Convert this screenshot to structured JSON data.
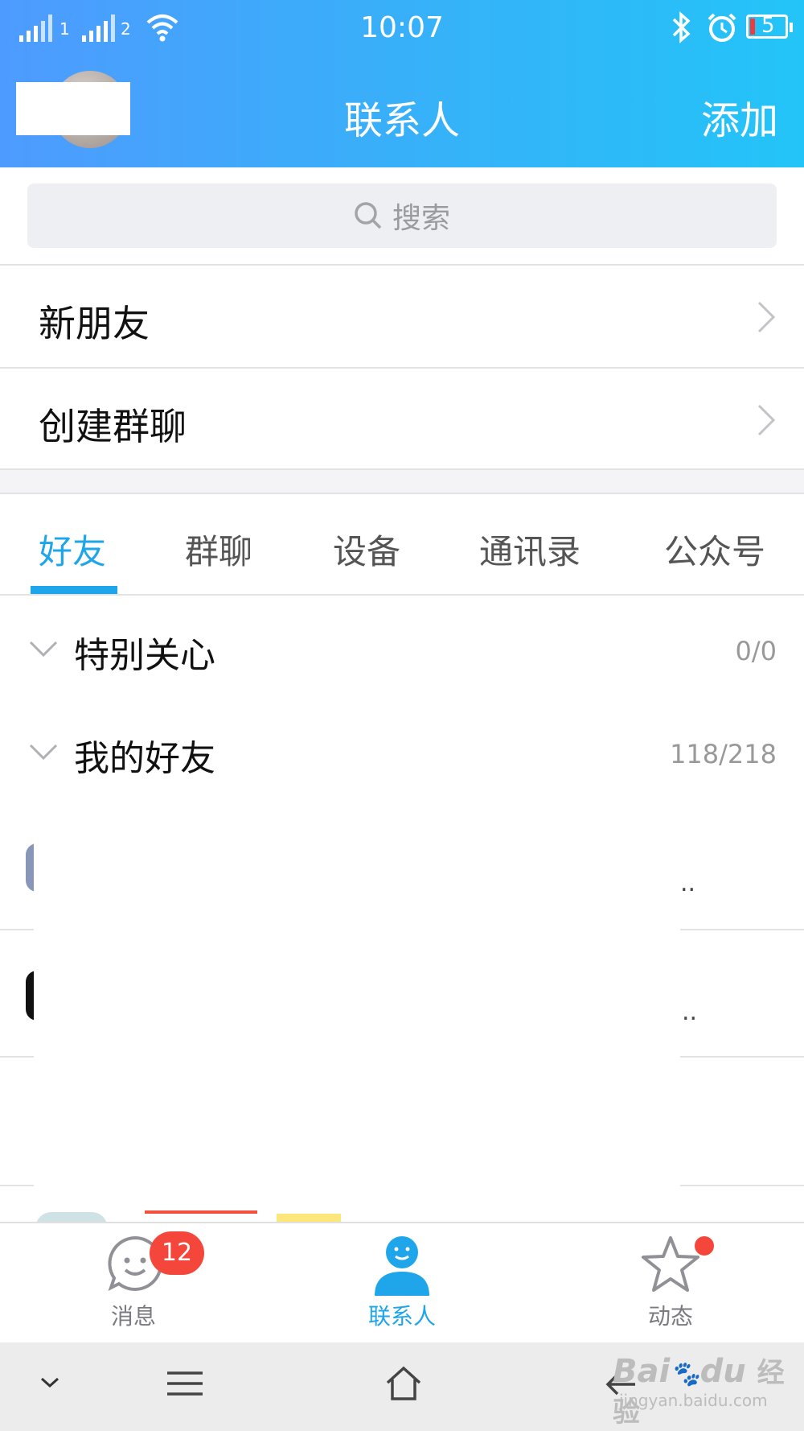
{
  "status_bar": {
    "sim1": "1",
    "sim2": "2",
    "time": "10:07",
    "battery": "5"
  },
  "header": {
    "title": "联系人",
    "add_label": "添加"
  },
  "search": {
    "placeholder": "搜索"
  },
  "menu": [
    {
      "label": "新朋友"
    },
    {
      "label": "创建群聊"
    }
  ],
  "tabs": [
    {
      "label": "好友",
      "active": true
    },
    {
      "label": "群聊"
    },
    {
      "label": "设备"
    },
    {
      "label": "通讯录"
    },
    {
      "label": "公众号"
    }
  ],
  "groups": [
    {
      "name": "特别关心",
      "count": "0/0"
    },
    {
      "name": "我的好友",
      "count": "118/218"
    }
  ],
  "partial_rows": [
    {
      "suffix": ".."
    },
    {
      "suffix": ".."
    }
  ],
  "bottom_nav": [
    {
      "label": "消息",
      "badge": "12"
    },
    {
      "label": "联系人",
      "active": true
    },
    {
      "label": "动态"
    }
  ],
  "watermark": {
    "brand": "Bai",
    "brand2": "du",
    "text": "经验",
    "url": "jingyan.baidu.com"
  },
  "colors": {
    "accent": "#1ea5ea",
    "badge": "#f4463b",
    "header_start": "#4e9bff",
    "header_end": "#23c4f8"
  }
}
